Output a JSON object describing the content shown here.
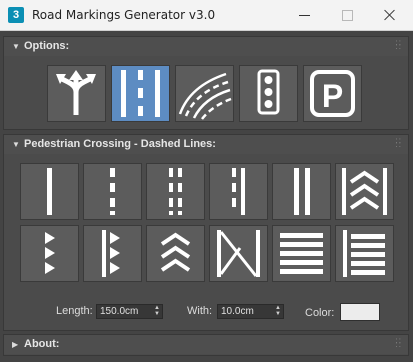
{
  "window": {
    "title": "Road Markings Generator v3.0",
    "app_icon_text": "3"
  },
  "options": {
    "title": "Options:",
    "buttons": [
      {
        "name": "intersection-arrows-icon"
      },
      {
        "name": "dashed-lane-icon",
        "active": true
      },
      {
        "name": "curved-lines-icon"
      },
      {
        "name": "traffic-light-icon"
      },
      {
        "name": "parking-icon",
        "glyph": "P"
      }
    ]
  },
  "pedestrian": {
    "title": "Pedestrian Crossing - Dashed Lines:",
    "length_label": "Length:",
    "length_value": "150.0cm",
    "width_label": "With:",
    "width_value": "10.0cm",
    "color_label": "Color:",
    "color_value": "#ececec"
  },
  "about": {
    "title": "About:"
  },
  "colors": {
    "active": "#5d8cc2",
    "panel": "#444444",
    "button": "#5c5c5c"
  }
}
